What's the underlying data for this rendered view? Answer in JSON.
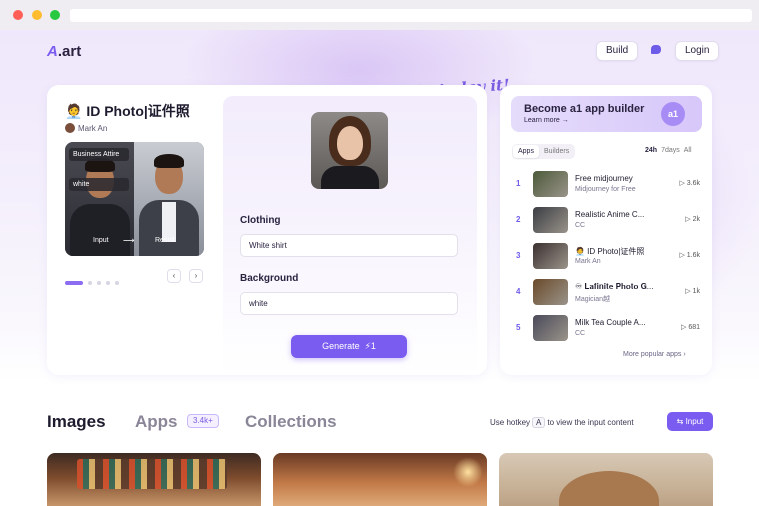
{
  "header": {
    "logo": ".art",
    "build_label": "Build",
    "login_label": "Login"
  },
  "tagline": "Just play it!",
  "app_card": {
    "title": "🧑‍💼 ID Photo|证件照",
    "author": "Mark An",
    "preview_tags": [
      "Business Attire",
      "white"
    ],
    "preview_input": "Input",
    "preview_result": "Result",
    "fields": [
      {
        "label": "Clothing",
        "value": "White shirt"
      },
      {
        "label": "Background",
        "value": "white"
      }
    ],
    "generate_label": "Generate",
    "generate_cost": "⚡1"
  },
  "ranking": {
    "banner_title": "Become a1 app builder",
    "banner_sub": "Learn more →",
    "banner_badge": "a1",
    "tabs": [
      "Apps",
      "Builders"
    ],
    "ranges": [
      "24h",
      "7days",
      "All"
    ],
    "items": [
      {
        "rank": "1",
        "title": "Free midjourney",
        "sub": "Midjourney for Free",
        "count": "▷ 3.6k",
        "thumb": "#4c5a3a"
      },
      {
        "rank": "2",
        "title": "Realistic Anime C...",
        "sub": "CC",
        "count": "▷ 2k",
        "thumb": "#3a3d44"
      },
      {
        "rank": "3",
        "title": "🧑‍💼 ID Photo|证件照",
        "sub": "Mark An",
        "count": "▷ 1.6k",
        "thumb": "#3b3030"
      },
      {
        "rank": "4",
        "title": "♾ 𝐋𝐚𝐟𝐢𝐧𝐢𝐭𝐞 𝐏𝐡𝐨𝐭𝐨 𝐆...",
        "sub": "Magician越",
        "count": "▷ 1k",
        "thumb": "#6a4a2a"
      },
      {
        "rank": "5",
        "title": "Milk Tea Couple A...",
        "sub": "CC",
        "count": "▷ 681",
        "thumb": "#4a4a5a"
      }
    ],
    "more_label": "More popular apps ›"
  },
  "sections": {
    "images": "Images",
    "apps": "Apps",
    "apps_count": "3.4k+",
    "collections": "Collections",
    "hotkey_prefix": "Use hotkey",
    "hotkey_key": "A",
    "hotkey_suffix": "to view the input content",
    "input_label": "⇆ Input"
  },
  "colors": {
    "accent": "#7a5cf0",
    "rank_number": "#6e5be8"
  }
}
